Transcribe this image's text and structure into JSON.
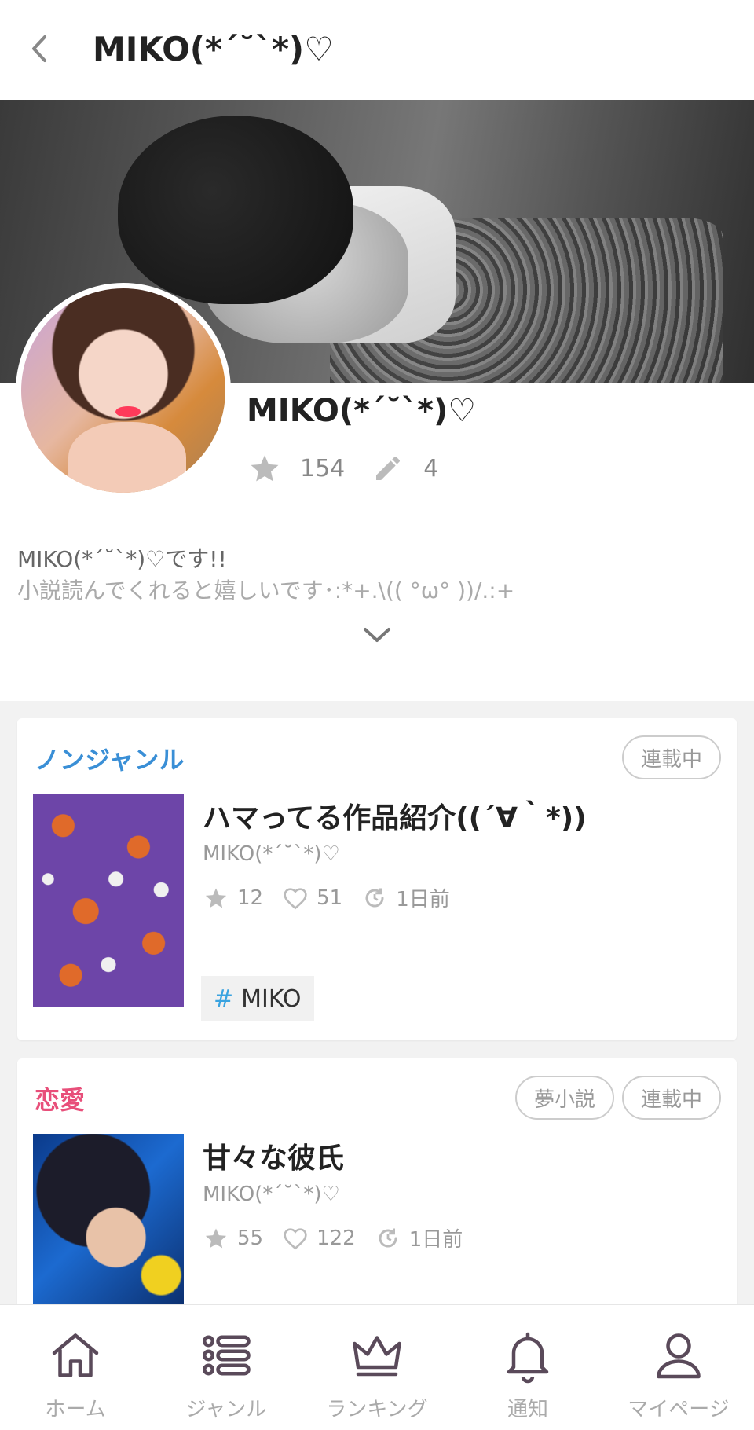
{
  "header": {
    "title": "MIKO(*´˘`*)♡"
  },
  "profile": {
    "name": "MIKO(*´˘`*)♡",
    "stars": "154",
    "works": "4",
    "bio_line1": "MIKO(*´˘`*)♡です!!",
    "bio_line2": "小説読んでくれると嬉しいです･:*+.\\(( °ω° ))/.:+"
  },
  "works": [
    {
      "genre": "ノンジャンル",
      "genre_color": "#3a8fd6",
      "badges": [
        "連載中"
      ],
      "title": "ハマってる作品紹介((´∀｀*))",
      "author": "MIKO(*´˘`*)♡",
      "stars": "12",
      "likes": "51",
      "updated": "1日前",
      "tag": "MIKO"
    },
    {
      "genre": "恋愛",
      "genre_color": "#e84f7a",
      "badges": [
        "夢小説",
        "連載中"
      ],
      "title": "甘々な彼氏",
      "author": "MIKO(*´˘`*)♡",
      "stars": "55",
      "likes": "122",
      "updated": "1日前"
    }
  ],
  "nav": {
    "items": [
      {
        "label": "ホーム",
        "icon": "home-icon"
      },
      {
        "label": "ジャンル",
        "icon": "list-icon"
      },
      {
        "label": "ランキング",
        "icon": "crown-icon"
      },
      {
        "label": "通知",
        "icon": "bell-icon"
      },
      {
        "label": "マイページ",
        "icon": "person-icon"
      }
    ]
  },
  "colors": {
    "nav_icon": "#5a4a5a",
    "tag_hash": "#3aa3e0",
    "meta_gray": "#999999"
  }
}
